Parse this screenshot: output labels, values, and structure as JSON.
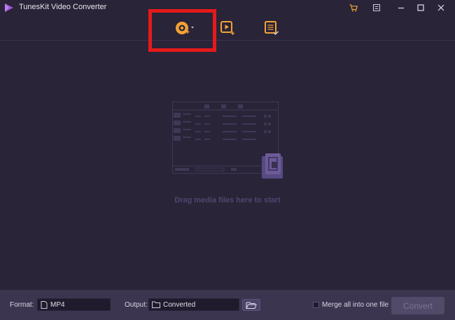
{
  "app": {
    "title": "TunesKit Video Converter"
  },
  "titlebar": {
    "icons": [
      "cart-icon",
      "menu-icon",
      "minimize-icon",
      "maximize-icon",
      "close-icon"
    ]
  },
  "toolbar": {
    "buttons": [
      {
        "name": "add-dvd-button",
        "icon": "disc-add-icon"
      },
      {
        "name": "add-files-button",
        "icon": "video-add-icon"
      },
      {
        "name": "converted-history-button",
        "icon": "list-check-icon"
      }
    ]
  },
  "drop_area": {
    "hint": "Drag media files here to start"
  },
  "footer": {
    "format_label": "Format:",
    "format_value": "MP4",
    "output_label": "Output:",
    "output_value": "Converted",
    "merge_label": "Merge all into one file",
    "merge_checked": false,
    "convert_label": "Convert"
  },
  "colors": {
    "background": "#2a2438",
    "footer": "#3b3550",
    "accent": "#f2a234",
    "highlight": "#e51a1a",
    "logo": "#9b59d0"
  }
}
